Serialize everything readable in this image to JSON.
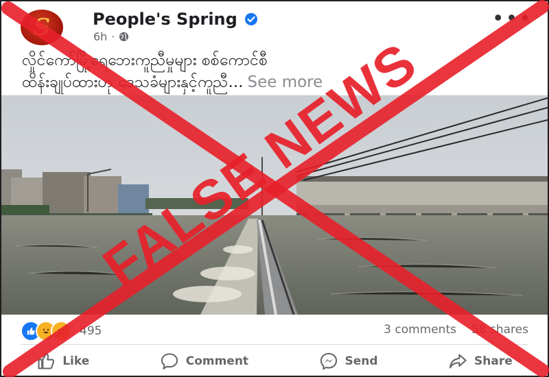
{
  "post": {
    "page_name": "People's Spring",
    "avatar_letter": "S",
    "time": "6h",
    "caption_line1": "လှိုင်ကော်မြို့ရေဘေးကူညီမှုများ စစ်ကောင်စီ",
    "caption_line2": "ထိန်းချုပ်ထားဟု ဒေသခံများနှင့်ကူညီ...",
    "see_more": "See more"
  },
  "stats": {
    "reaction_count": "495",
    "comments": "3 comments",
    "shares": "58 shares"
  },
  "actions": {
    "like": "Like",
    "comment": "Comment",
    "send": "Send",
    "share": "Share"
  },
  "overlay": {
    "stamp_text": "FALSE NEWS"
  },
  "colors": {
    "cross": "#e8202a",
    "verified": "#1877f2",
    "muted": "#65676b"
  }
}
